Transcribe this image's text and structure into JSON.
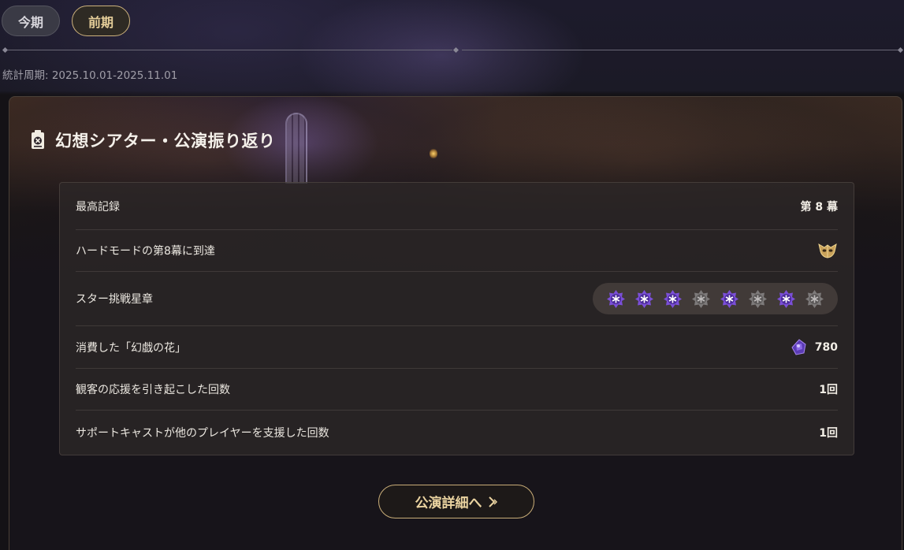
{
  "tabs": [
    {
      "label": "今期",
      "selected": false
    },
    {
      "label": "前期",
      "selected": true
    }
  ],
  "period_text": "統計周期: 2025.10.01-2025.11.01",
  "card": {
    "title": "幻想シアター・公演振り返り",
    "title_icon": "theater-card-icon",
    "rows": [
      {
        "label": "最高記録",
        "value": "第 8 幕"
      },
      {
        "label": "ハードモードの第8幕に到達",
        "value_icon": "golden-mask-icon"
      },
      {
        "label": "スター挑戦星章",
        "badges": [
          true,
          true,
          true,
          false,
          true,
          false,
          true,
          false
        ]
      },
      {
        "label": "消費した「幻戯の花」",
        "value": "780",
        "value_icon": "fantasia-flower-icon"
      },
      {
        "label": "観客の応援を引き起こした回数",
        "value": "1回"
      },
      {
        "label": "サポートキャストが他のプレイヤーを支援した回数",
        "value": "1回"
      }
    ],
    "detail_button": "公演詳細へ"
  },
  "colors": {
    "accent_gold": "#c9ad78",
    "badge_active": "#7b4fd8",
    "badge_inactive": "#7d7a7a"
  }
}
